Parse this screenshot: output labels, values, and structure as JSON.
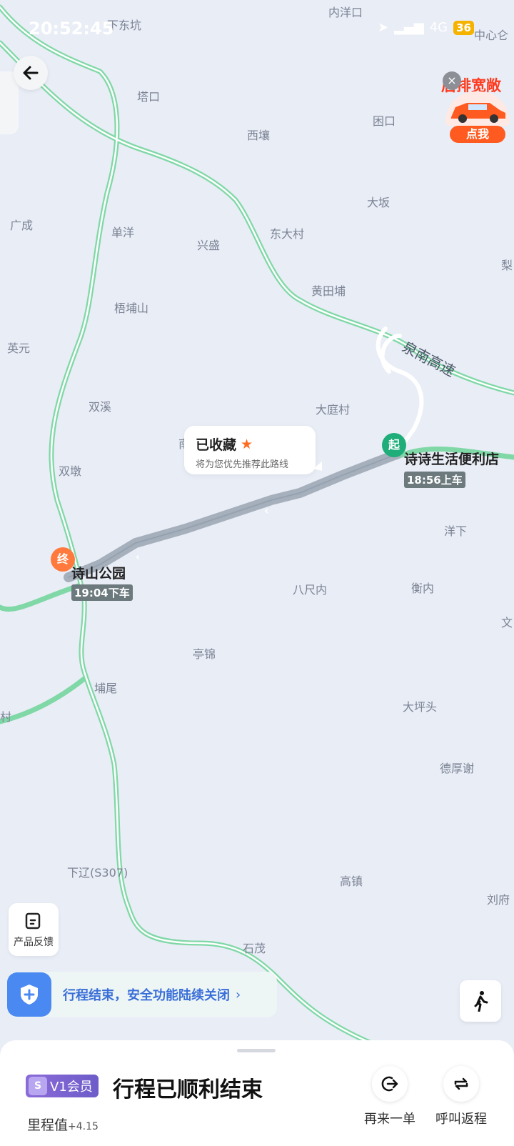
{
  "status_bar": {
    "time": "20:52:45",
    "network": "4G",
    "battery": "36"
  },
  "map": {
    "places": [
      {
        "name": "内洋口"
      },
      {
        "name": "下东坑"
      },
      {
        "name": "中心仑"
      },
      {
        "name": "塔口"
      },
      {
        "name": "困口"
      },
      {
        "name": "西壤"
      },
      {
        "name": "大坂"
      },
      {
        "name": "广成"
      },
      {
        "name": "单洋"
      },
      {
        "name": "兴盛"
      },
      {
        "name": "东大村"
      },
      {
        "name": "梨"
      },
      {
        "name": "黄田埔"
      },
      {
        "name": "梧埔山"
      },
      {
        "name": "英元"
      },
      {
        "name": "双溪"
      },
      {
        "name": "大庭村"
      },
      {
        "name": "双墩"
      },
      {
        "name": "洋下"
      },
      {
        "name": "八尺内"
      },
      {
        "name": "衡内"
      },
      {
        "name": "文"
      },
      {
        "name": "亭锦"
      },
      {
        "name": "埔尾"
      },
      {
        "name": "大坪头"
      },
      {
        "name": "村"
      },
      {
        "name": "德厚谢"
      },
      {
        "name": "下辽(S307)"
      },
      {
        "name": "高镇"
      },
      {
        "name": "刘府"
      },
      {
        "name": "石茂"
      },
      {
        "name": "南"
      }
    ],
    "highway_label": "泉南高速"
  },
  "ad": {
    "title": "后排宽敞",
    "button": "点我"
  },
  "bubble": {
    "title": "已收藏",
    "subtitle": "将为您优先推荐此路线"
  },
  "start": {
    "marker": "起",
    "name": "诗诗生活便利店",
    "time": "18:56上车"
  },
  "end": {
    "marker": "终",
    "name": "诗山公园",
    "time": "19:04下车"
  },
  "feedback": {
    "label": "产品反馈"
  },
  "safety": {
    "text": "行程结束，安全功能陆续关闭"
  },
  "sheet": {
    "vip_label": "V1会员",
    "title": "行程已顺利结束",
    "mileage_label": "里程值",
    "mileage_bonus": "+4.15",
    "actions": [
      {
        "label": "再来一单",
        "icon": "reorder-icon"
      },
      {
        "label": "呼叫返程",
        "icon": "return-trip-icon"
      }
    ]
  },
  "colors": {
    "road": "#7fd8a6",
    "route": "#a6b0bc",
    "start": "#1fad7a",
    "end": "#ff7a3c",
    "accent": "#3a6fd8"
  }
}
